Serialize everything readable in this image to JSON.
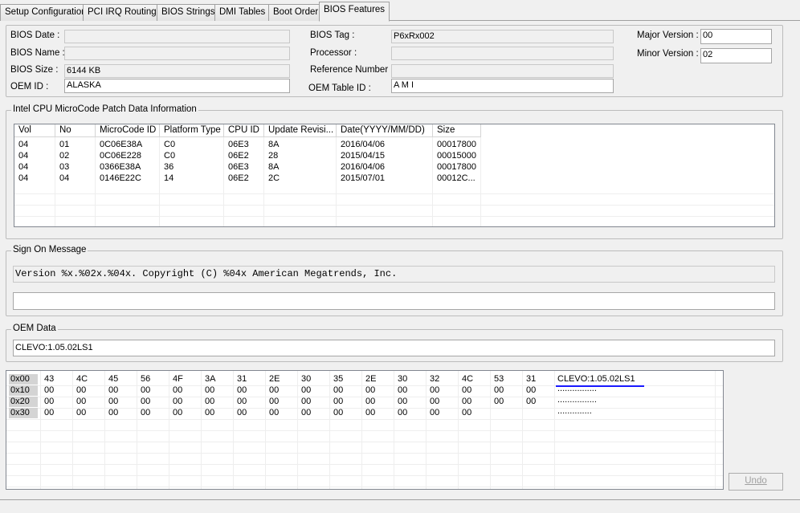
{
  "tabs": [
    "Setup Configuration",
    "PCI IRQ Routing",
    "BIOS Strings",
    "DMI Tables",
    "Boot Order",
    "BIOS Features"
  ],
  "bios_info": {
    "bios_date_label": "BIOS Date :",
    "bios_date": "",
    "bios_name_label": "BIOS Name :",
    "bios_name": "",
    "bios_size_label": "BIOS Size :",
    "bios_size": "6144 KB",
    "oem_id_label": "OEM ID :",
    "oem_id": "ALASKA",
    "bios_tag_label": "BIOS Tag :",
    "bios_tag": "P6xRx002",
    "processor_label": "Processor :",
    "processor": "",
    "reference_number_label": "Reference Number :",
    "reference_number": "",
    "oem_table_id_label": "OEM Table ID :",
    "oem_table_id": "A M I",
    "major_version_label": "Major Version :",
    "major_version": "00",
    "minor_version_label": "Minor Version :",
    "minor_version": "02"
  },
  "microcode": {
    "title": "Intel CPU MicroCode Patch Data Information",
    "columns": [
      "Vol",
      "No",
      "MicroCode ID",
      "Platform Type",
      "CPU ID",
      "Update Revisi...",
      "Date(YYYY/MM/DD)",
      "Size"
    ],
    "rows": [
      [
        "04",
        "01",
        "0C06E38A",
        "C0",
        "06E3",
        "8A",
        "2016/04/06",
        "00017800"
      ],
      [
        "04",
        "02",
        "0C06E228",
        "C0",
        "06E2",
        "28",
        "2015/04/15",
        "00015000"
      ],
      [
        "04",
        "03",
        "0366E38A",
        "36",
        "06E3",
        "8A",
        "2016/04/06",
        "00017800"
      ],
      [
        "04",
        "04",
        "0146E22C",
        "14",
        "06E2",
        "2C",
        "2015/07/01",
        "00012C..."
      ]
    ]
  },
  "sign_on": {
    "title": "Sign On Message",
    "message": "Version %x.%02x.%04x. Copyright (C) %04x American Megatrends, Inc.",
    "second_line": ""
  },
  "oem_data": {
    "title": "OEM Data",
    "value": "CLEVO:1.05.02LS1"
  },
  "hex": {
    "rows": [
      {
        "addr": "0x00",
        "bytes": [
          "43",
          "4C",
          "45",
          "56",
          "4F",
          "3A",
          "31",
          "2E",
          "30",
          "35",
          "2E",
          "30",
          "32",
          "4C",
          "53",
          "31"
        ],
        "ascii": "CLEVO:1.05.02LS1"
      },
      {
        "addr": "0x10",
        "bytes": [
          "00",
          "00",
          "00",
          "00",
          "00",
          "00",
          "00",
          "00",
          "00",
          "00",
          "00",
          "00",
          "00",
          "00",
          "00",
          "00"
        ],
        "ascii": "................"
      },
      {
        "addr": "0x20",
        "bytes": [
          "00",
          "00",
          "00",
          "00",
          "00",
          "00",
          "00",
          "00",
          "00",
          "00",
          "00",
          "00",
          "00",
          "00",
          "00",
          "00"
        ],
        "ascii": "................"
      },
      {
        "addr": "0x30",
        "bytes": [
          "00",
          "00",
          "00",
          "00",
          "00",
          "00",
          "00",
          "00",
          "00",
          "00",
          "00",
          "00",
          "00",
          "00"
        ],
        "ascii": ".............."
      }
    ]
  },
  "undo_label": "Undo",
  "colors": {
    "ascii_underline": "#1a1aff"
  }
}
